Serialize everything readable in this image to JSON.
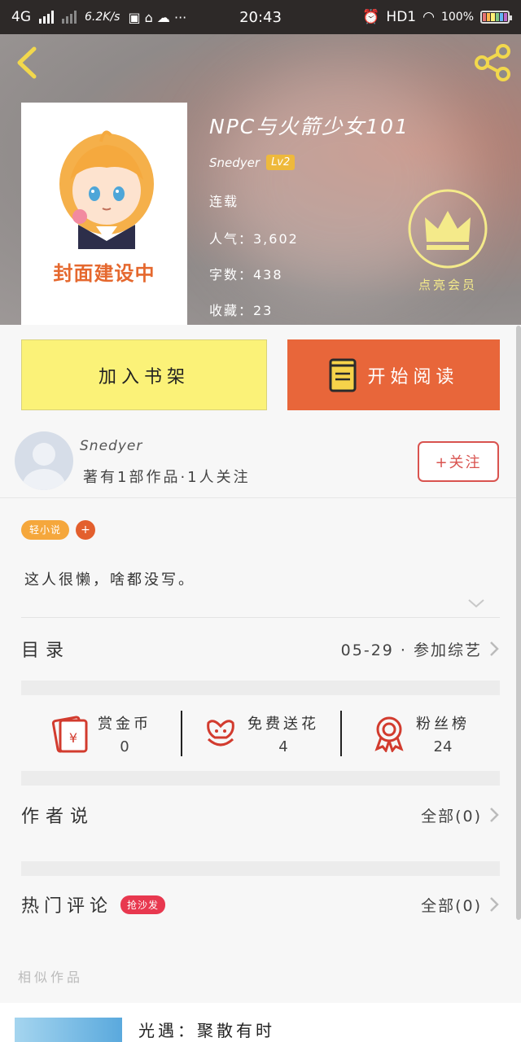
{
  "status_bar": {
    "network": "4G",
    "speed": "6.2K/s",
    "time": "20:43",
    "hd": "HD1",
    "battery": "100%"
  },
  "header": {
    "cover_text": "封面建设中",
    "title": "NPC与火箭少女101",
    "author": "Snedyer",
    "level": "Lv2",
    "status": "连载",
    "popularity": "人气：3,602",
    "word_count": "字数：438",
    "favorites": "收藏：23",
    "vip_label": "点亮会员"
  },
  "actions": {
    "add_shelf": "加入书架",
    "start_read": "开始阅读"
  },
  "author_card": {
    "name": "Snedyer",
    "stats": "著有1部作品·1人关注",
    "follow": "+关注"
  },
  "tags": [
    "轻小说"
  ],
  "tag_add": "+",
  "intro": "这人很懒，啥都没写。",
  "catalog": {
    "title": "目录",
    "latest": "05-29 · 参加综艺"
  },
  "stats": [
    {
      "label": "赏金币",
      "value": "0",
      "icon": "red-envelope-icon"
    },
    {
      "label": "免费送花",
      "value": "4",
      "icon": "flower-icon"
    },
    {
      "label": "粉丝榜",
      "value": "24",
      "icon": "ribbon-award-icon"
    }
  ],
  "author_says": {
    "title": "作者说",
    "all": "全部(0)"
  },
  "hot_comments": {
    "title": "热门评论",
    "badge": "抢沙发",
    "all": "全部(0)"
  },
  "similar": {
    "label": "相似作品",
    "first_title": "光遇：聚散有时"
  },
  "colors": {
    "accent_orange": "#e8663a",
    "shelf_yellow": "#fbf278",
    "follow_red": "#d9534f",
    "tag_orange": "#f5a73c",
    "hot_red": "#e8384f"
  }
}
